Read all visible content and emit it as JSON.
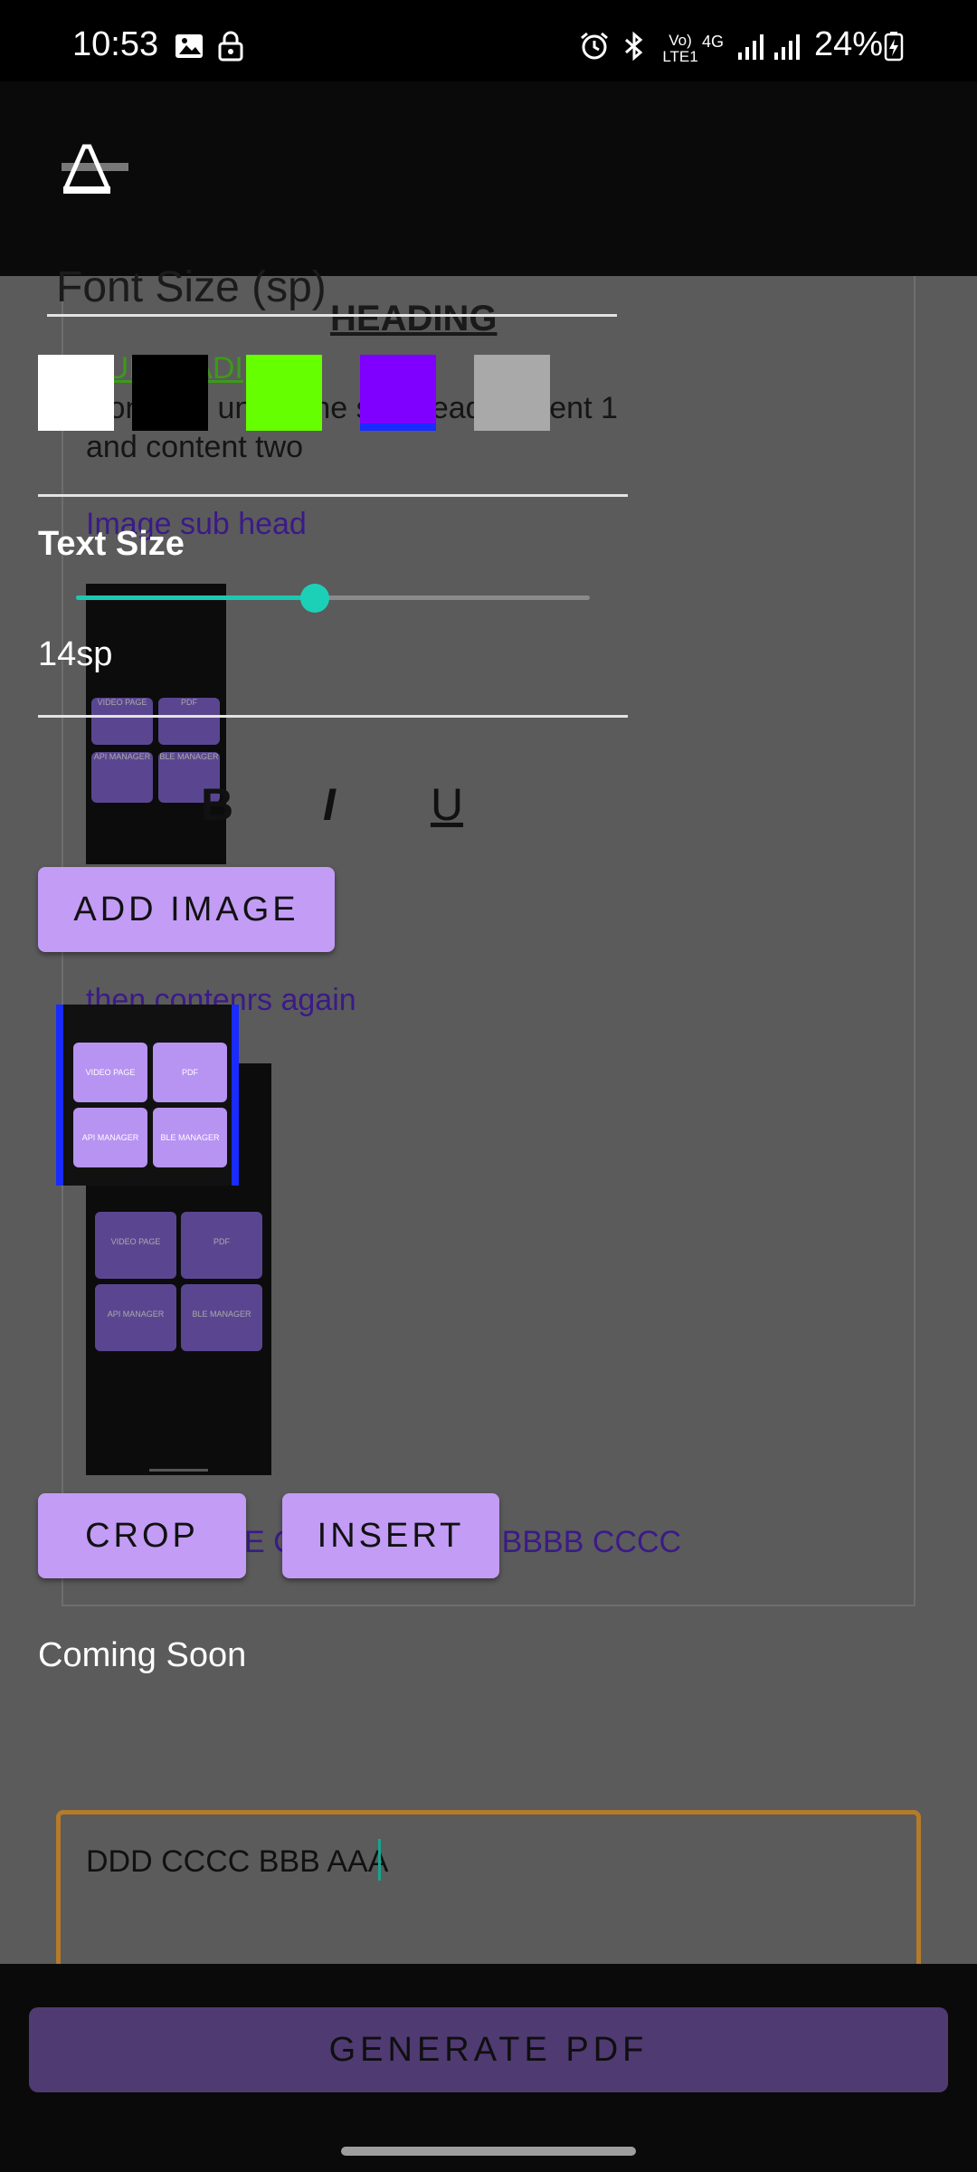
{
  "status_bar": {
    "time": "10:53",
    "network_label": "Vo) LTE1",
    "network_gen": "4G",
    "battery": "24%"
  },
  "toolbar": {
    "icon": "text-format-icon"
  },
  "document_preview": {
    "heading": "HEADING",
    "subheading": "SUBHEADI",
    "content": "Contents under the sub head content 1 and content two",
    "image_subhead": "Image sub head",
    "then_contents": "then contenrs again",
    "last_content": "E C     NTENT AAAA BBBB CCCC",
    "tile_labels": [
      "VIDEO PAGE",
      "PDF",
      "API MANAGER",
      "BLE MANAGER"
    ]
  },
  "editor": {
    "font_size_placeholder": "Font Size (sp)",
    "colors": [
      "#ffffff",
      "#000000",
      "#66ff00",
      "#7f00ff",
      "#a9a9a9"
    ],
    "selected_color_index": 3,
    "text_size_label": "Text Size",
    "text_size_value": "14sp",
    "text_size_slider_fraction": 0.46,
    "format_buttons": {
      "bold": "B",
      "italic": "I",
      "underline": "U"
    },
    "add_image_label": "ADD IMAGE",
    "crop_label": "CROP",
    "insert_label": "INSERT",
    "selected_image_tiles": [
      "VIDEO PAGE",
      "PDF",
      "API MANAGER",
      "BLE MANAGER"
    ],
    "coming_soon": "Coming Soon",
    "input_text": "DDD CCCC BBB AAA"
  },
  "bottom": {
    "generate_label": "GENERATE PDF"
  }
}
